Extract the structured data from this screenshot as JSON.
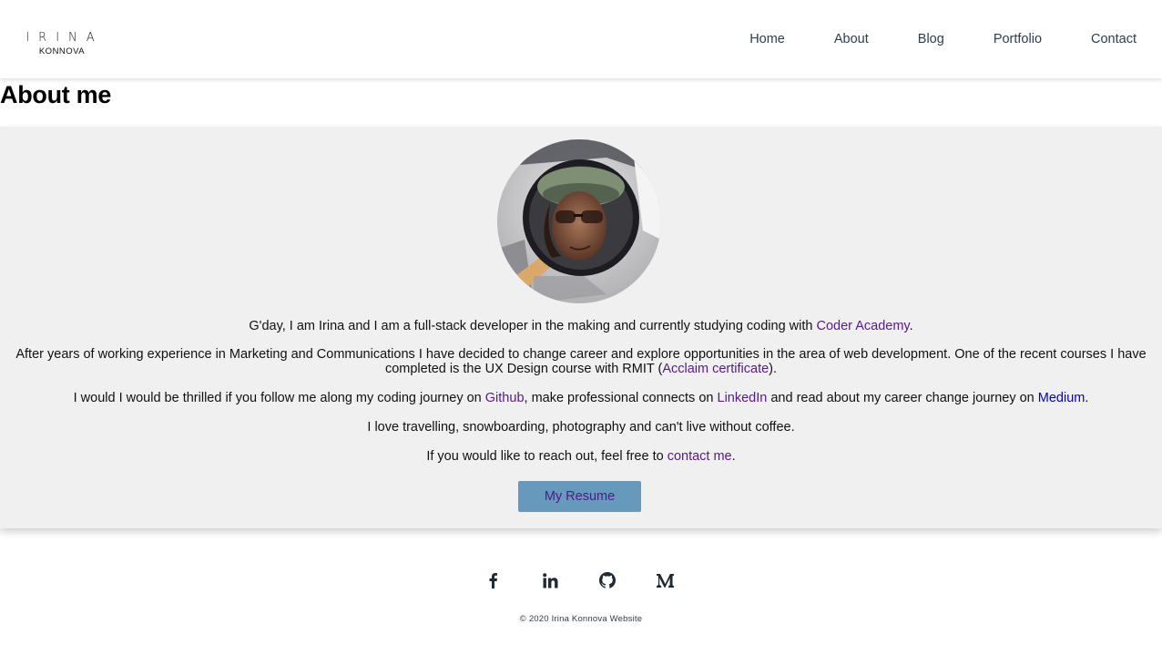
{
  "header": {
    "logo_top": "IRINA",
    "logo_bottom": "KONNOVA",
    "nav": [
      "Home",
      "About",
      "Blog",
      "Portfolio",
      "Contact"
    ]
  },
  "page_title": "About me",
  "about": {
    "p1_text": "G'day, I am Irina and I am a full-stack developer in the making and currently studying coding with ",
    "p1_link": "Coder Academy",
    "p1_end": ".",
    "p2_text": "After years of working experience in Marketing and Communications I have decided to change career and explore opportunities in the area of web development. One of the recent courses I have completed is the UX Design course with RMIT (",
    "p2_link": "Acclaim certificate",
    "p2_end": ").",
    "p3_a": "I would I would be thrilled if you follow me along my coding journey on ",
    "p3_link1": "Github",
    "p3_b": ", make professional connects on ",
    "p3_link2": "LinkedIn",
    "p3_c": " and read about my career change journey on ",
    "p3_link3": "Medium",
    "p3_end": ".",
    "p4_text": "I love travelling, snowboarding, photography and can't live without coffee.",
    "p5_text": "If you would like to reach out, feel free to ",
    "p5_link": "contact me",
    "p5_end": ".",
    "resume_label": "My Resume"
  },
  "footer": {
    "social_icons": [
      "facebook-icon",
      "linkedin-icon",
      "github-icon",
      "medium-icon"
    ],
    "copyright": "© 2020 Irina Konnova Website"
  },
  "colors": {
    "card_bg": "#f0f0f0",
    "nav_text": "#2c3e50",
    "visited_link": "#551a8b",
    "link": "#0000cc",
    "button_bg": "#6699bb"
  }
}
